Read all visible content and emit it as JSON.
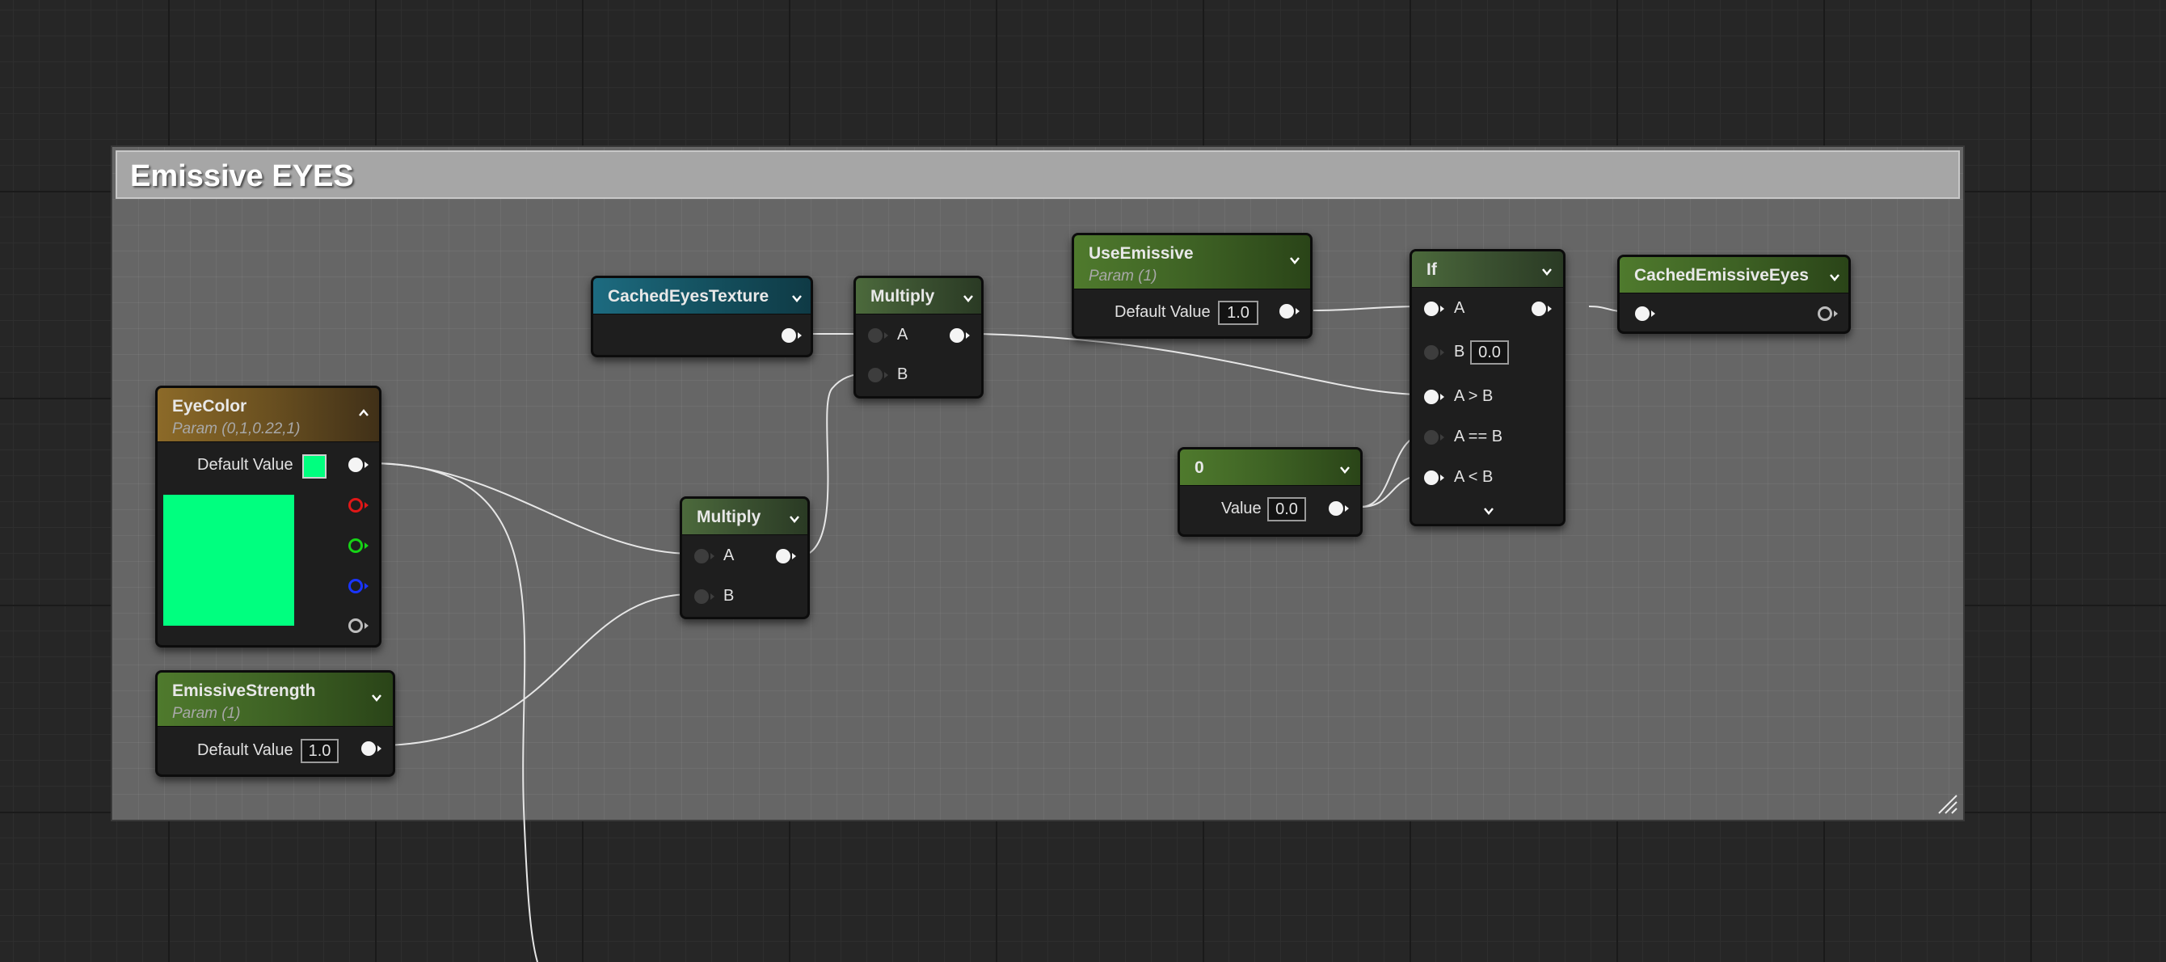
{
  "comment": {
    "title": "Emissive EYES"
  },
  "nodes": {
    "cached_eyes_texture": {
      "title": "CachedEyesTexture"
    },
    "multiply_top": {
      "title": "Multiply",
      "pin_a": "A",
      "pin_b": "B"
    },
    "use_emissive": {
      "title": "UseEmissive",
      "subtitle": "Param (1)",
      "default_label": "Default Value",
      "default_value": "1.0"
    },
    "if_node": {
      "title": "If",
      "pin_a": "A",
      "pin_b": "B",
      "b_value": "0.0",
      "pin_a_gt_b": "A > B",
      "pin_a_eq_b": "A == B",
      "pin_a_lt_b": "A < B"
    },
    "cached_emissive_eyes": {
      "title": "CachedEmissiveEyes"
    },
    "eye_color": {
      "title": "EyeColor",
      "subtitle": "Param (0,1,0.22,1)",
      "default_label": "Default Value",
      "color": "#00ff7f"
    },
    "multiply_bottom": {
      "title": "Multiply",
      "pin_a": "A",
      "pin_b": "B"
    },
    "constant_zero": {
      "title": "0",
      "value_label": "Value",
      "value": "0.0"
    },
    "emissive_strength": {
      "title": "EmissiveStrength",
      "subtitle": "Param (1)",
      "default_label": "Default Value",
      "default_value": "1.0"
    }
  },
  "colors": {
    "comment_header": "#a6a6a6",
    "comment_body": "#666666",
    "texture_header": "#1d6b80",
    "multiply_header": "#4c6a3c",
    "param_header": "#4f7a2d",
    "vector_param_header": "#8c6a28",
    "pin_red": "#e01717",
    "pin_green": "#16d316",
    "pin_blue": "#1a35ff"
  },
  "icons": [
    "chevron-down-icon",
    "chevron-up-icon",
    "resize-handle-icon"
  ]
}
